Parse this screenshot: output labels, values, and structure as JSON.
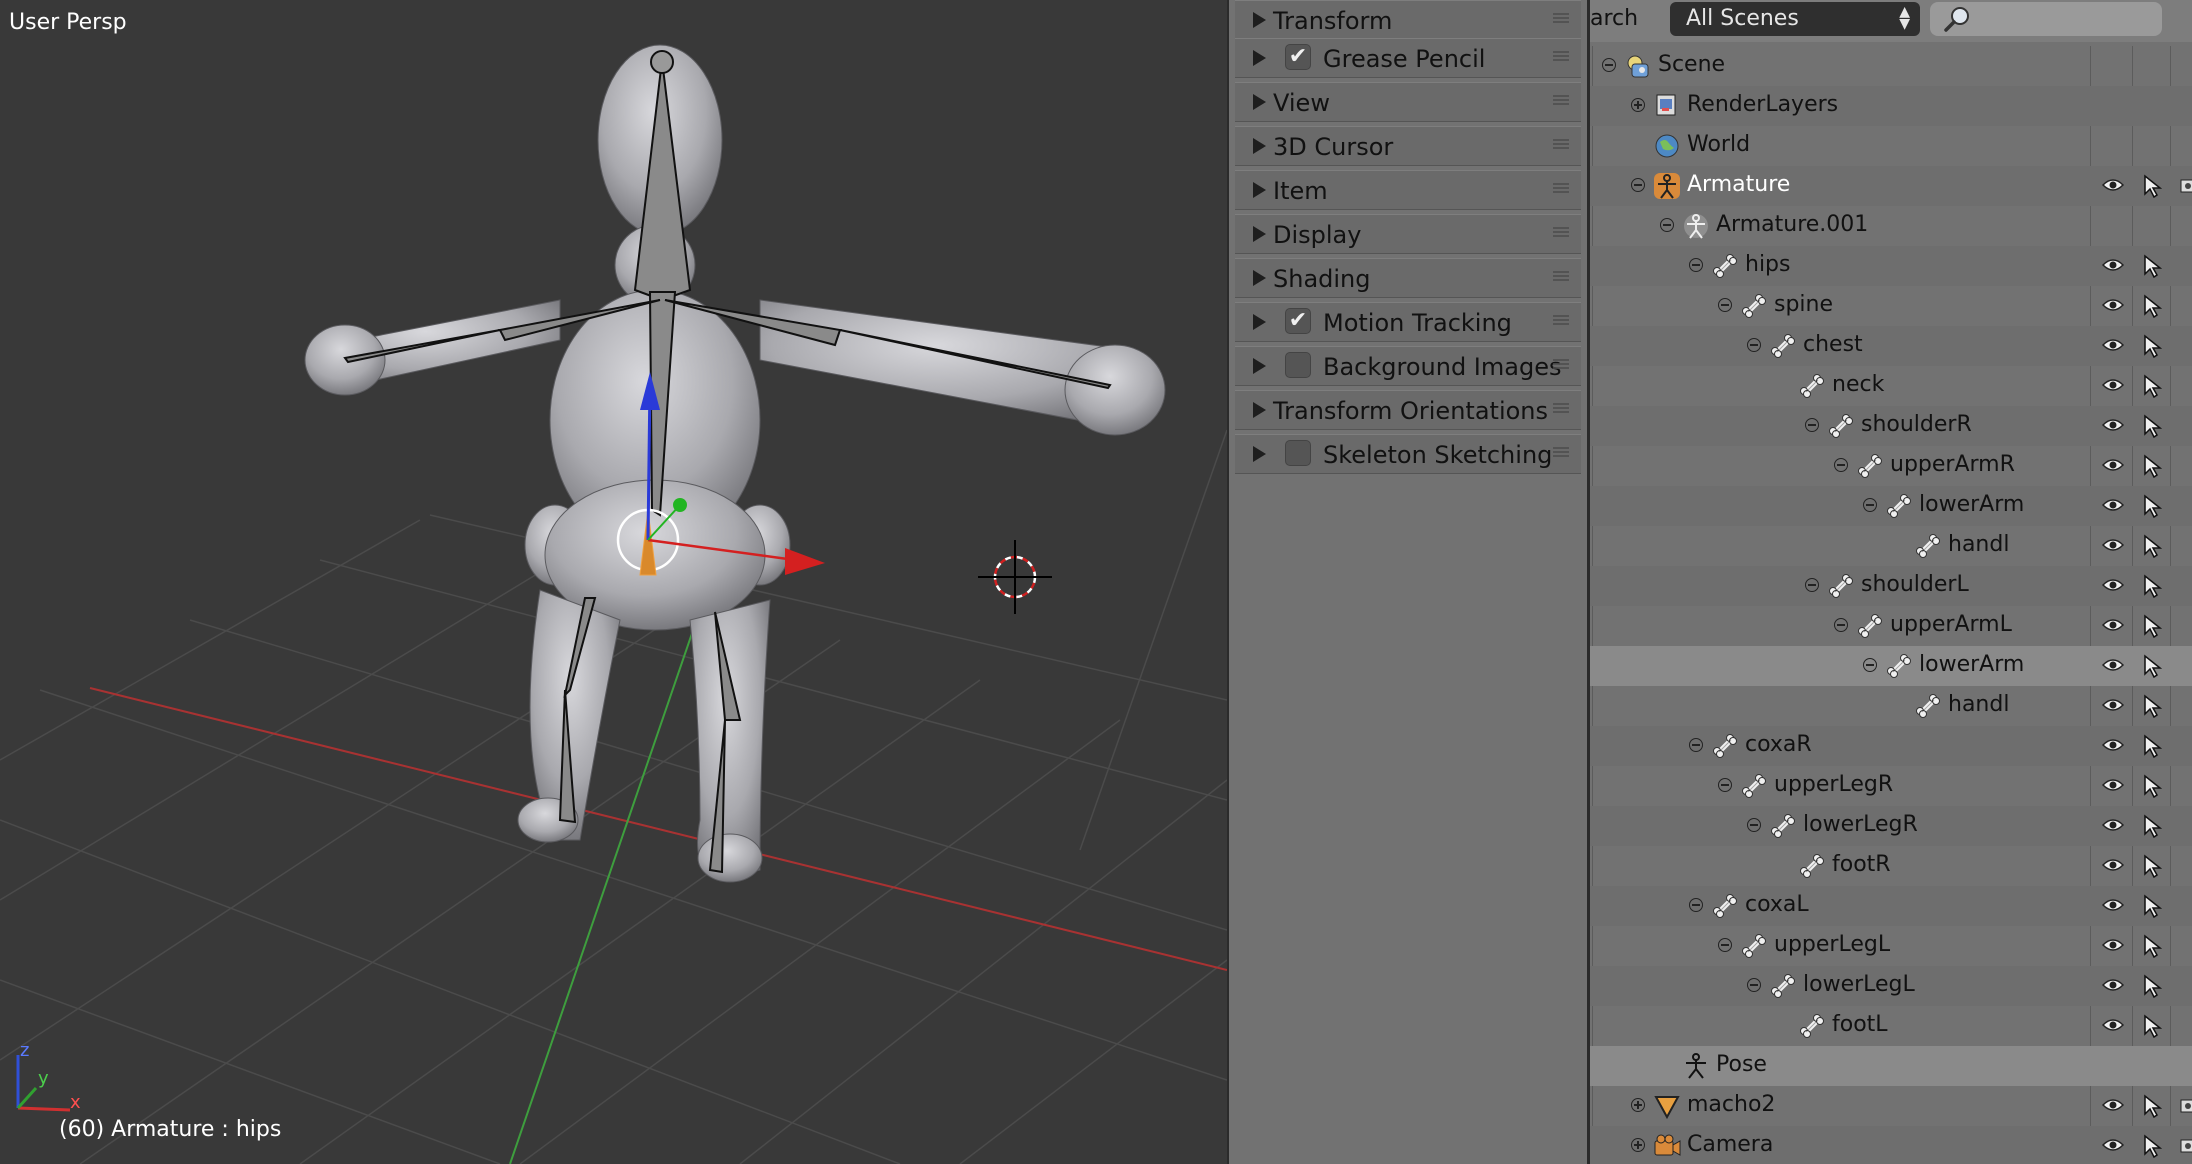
{
  "viewport": {
    "view_label": "User Persp",
    "status": "(60) Armature : hips",
    "axis_labels": {
      "x": "x",
      "y": "y",
      "z": "z"
    }
  },
  "properties_panel": {
    "sections": [
      {
        "label": "Transform",
        "checkbox": null
      },
      {
        "label": "Grease Pencil",
        "checkbox": true
      },
      {
        "label": "View",
        "checkbox": null
      },
      {
        "label": "3D Cursor",
        "checkbox": null
      },
      {
        "label": "Item",
        "checkbox": null
      },
      {
        "label": "Display",
        "checkbox": null
      },
      {
        "label": "Shading",
        "checkbox": null
      },
      {
        "label": "Motion Tracking",
        "checkbox": true
      },
      {
        "label": "Background Images",
        "checkbox": false
      },
      {
        "label": "Transform Orientations",
        "checkbox": null
      },
      {
        "label": "Skeleton Sketching",
        "checkbox": false
      }
    ]
  },
  "outliner": {
    "search_label": "arch",
    "display_mode": "All Scenes",
    "search_placeholder": "",
    "items": [
      {
        "label": "Scene",
        "icon": "scene-icon",
        "toggle": "minus",
        "eye": false,
        "cursor": false,
        "render": false
      },
      {
        "label": "RenderLayers",
        "icon": "render-layers-icon",
        "toggle": "plus",
        "eye": false,
        "cursor": false,
        "render": false
      },
      {
        "label": "World",
        "icon": "world-icon",
        "toggle": null,
        "eye": false,
        "cursor": false,
        "render": false
      },
      {
        "label": "Armature",
        "icon": "armature-object-icon",
        "toggle": "minus",
        "eye": true,
        "cursor": true,
        "render": true,
        "highlight": true
      },
      {
        "label": "Armature.001",
        "icon": "armature-data-icon",
        "toggle": "minus",
        "eye": false,
        "cursor": false,
        "render": false
      },
      {
        "label": "hips",
        "icon": "bone-icon",
        "toggle": "minus",
        "eye": true,
        "cursor": true,
        "render": false
      },
      {
        "label": "spine",
        "icon": "bone-icon",
        "toggle": "minus",
        "eye": true,
        "cursor": true,
        "render": false
      },
      {
        "label": "chest",
        "icon": "bone-icon",
        "toggle": "minus",
        "eye": true,
        "cursor": true,
        "render": false
      },
      {
        "label": "neck",
        "icon": "bone-icon",
        "toggle": null,
        "eye": true,
        "cursor": true,
        "render": false
      },
      {
        "label": "shoulderR",
        "icon": "bone-icon",
        "toggle": "minus",
        "eye": true,
        "cursor": true,
        "render": false
      },
      {
        "label": "upperArmR",
        "icon": "bone-icon",
        "toggle": "minus",
        "eye": true,
        "cursor": true,
        "render": false
      },
      {
        "label": "lowerArm",
        "icon": "bone-icon",
        "toggle": "minus",
        "eye": true,
        "cursor": true,
        "render": false
      },
      {
        "label": "handl",
        "icon": "bone-icon",
        "toggle": null,
        "eye": true,
        "cursor": true,
        "render": false
      },
      {
        "label": "shoulderL",
        "icon": "bone-icon",
        "toggle": "minus",
        "eye": true,
        "cursor": true,
        "render": false
      },
      {
        "label": "upperArmL",
        "icon": "bone-icon",
        "toggle": "minus",
        "eye": true,
        "cursor": true,
        "render": false
      },
      {
        "label": "lowerArm",
        "icon": "bone-icon",
        "toggle": "minus",
        "eye": true,
        "cursor": true,
        "render": false,
        "selected": true
      },
      {
        "label": "handl",
        "icon": "bone-icon",
        "toggle": null,
        "eye": true,
        "cursor": true,
        "render": false
      },
      {
        "label": "coxaR",
        "icon": "bone-icon",
        "toggle": "minus",
        "eye": true,
        "cursor": true,
        "render": false
      },
      {
        "label": "upperLegR",
        "icon": "bone-icon",
        "toggle": "minus",
        "eye": true,
        "cursor": true,
        "render": false
      },
      {
        "label": "lowerLegR",
        "icon": "bone-icon",
        "toggle": "minus",
        "eye": true,
        "cursor": true,
        "render": false
      },
      {
        "label": "footR",
        "icon": "bone-icon",
        "toggle": null,
        "eye": true,
        "cursor": true,
        "render": false
      },
      {
        "label": "coxaL",
        "icon": "bone-icon",
        "toggle": "minus",
        "eye": true,
        "cursor": true,
        "render": false
      },
      {
        "label": "upperLegL",
        "icon": "bone-icon",
        "toggle": "minus",
        "eye": true,
        "cursor": true,
        "render": false
      },
      {
        "label": "lowerLegL",
        "icon": "bone-icon",
        "toggle": "minus",
        "eye": true,
        "cursor": true,
        "render": false
      },
      {
        "label": "footL",
        "icon": "bone-icon",
        "toggle": null,
        "eye": true,
        "cursor": true,
        "render": false
      },
      {
        "label": "Pose",
        "icon": "pose-icon",
        "toggle": null,
        "eye": false,
        "cursor": false,
        "render": false,
        "selected": true
      },
      {
        "label": "macho2",
        "icon": "mesh-icon",
        "toggle": "plus",
        "eye": true,
        "cursor": true,
        "render": true
      },
      {
        "label": "Camera",
        "icon": "camera-icon",
        "toggle": "plus",
        "eye": true,
        "cursor": true,
        "render": true
      }
    ]
  }
}
